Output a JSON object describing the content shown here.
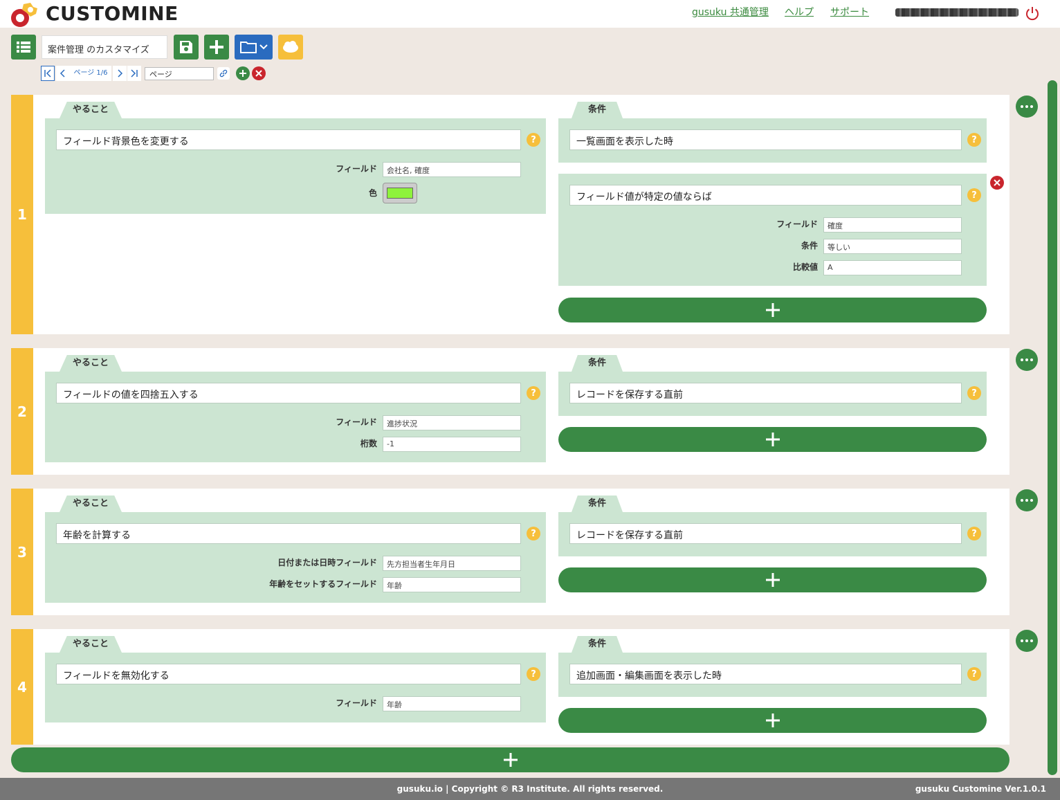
{
  "header": {
    "logo_text": "CUSTOMINE",
    "links": [
      "gusuku 共通管理",
      "ヘルプ",
      "サポート"
    ]
  },
  "toolbar": {
    "app_name": "案件管理 のカスタマイズ",
    "page_label": "ページ 1/6",
    "page_input": "ページ"
  },
  "rules": [
    {
      "number": "1",
      "action": {
        "tab": "やること",
        "name": "フィールド背景色を変更する",
        "params": [
          {
            "label": "フィールド",
            "value": "会社名, 確度"
          },
          {
            "label": "色",
            "value": ""
          }
        ]
      },
      "conditions_tab": "条件",
      "conditions": [
        {
          "name": "一覧画面を表示した時",
          "params": []
        },
        {
          "name": "フィールド値が特定の値ならば",
          "params": [
            {
              "label": "フィールド",
              "value": "確度"
            },
            {
              "label": "条件",
              "value": "等しい"
            },
            {
              "label": "比較値",
              "value": "A"
            }
          ]
        }
      ]
    },
    {
      "number": "2",
      "action": {
        "tab": "やること",
        "name": "フィールドの値を四捨五入する",
        "params": [
          {
            "label": "フィールド",
            "value": "進捗状況"
          },
          {
            "label": "桁数",
            "value": "-1"
          }
        ]
      },
      "conditions_tab": "条件",
      "conditions": [
        {
          "name": "レコードを保存する直前",
          "params": []
        }
      ]
    },
    {
      "number": "3",
      "action": {
        "tab": "やること",
        "name": "年齢を計算する",
        "params": [
          {
            "label": "日付または日時フィールド",
            "value": "先方担当者生年月日"
          },
          {
            "label": "年齢をセットするフィールド",
            "value": "年齢"
          }
        ]
      },
      "conditions_tab": "条件",
      "conditions": [
        {
          "name": "レコードを保存する直前",
          "params": []
        }
      ]
    },
    {
      "number": "4",
      "action": {
        "tab": "やること",
        "name": "フィールドを無効化する",
        "params": [
          {
            "label": "フィールド",
            "value": "年齢"
          }
        ]
      },
      "conditions_tab": "条件",
      "conditions": [
        {
          "name": "追加画面・編集画面を表示した時",
          "params": []
        }
      ]
    }
  ],
  "help_glyph": "?",
  "footer": {
    "copyright": "gusuku.io | Copyright © R3 Institute. All rights reserved.",
    "version": "gusuku Customine Ver.1.0.1"
  },
  "colors": {
    "brand_green": "#3a8a45",
    "rule_yellow": "#f6bf3b",
    "panel_green": "#cce5d2",
    "delete_red": "#c9252d",
    "swatch_color": "#8ef23c"
  },
  "icons": [
    "logo-icon",
    "list-icon",
    "save-icon",
    "plus-icon",
    "folder-icon",
    "chevron-down-icon",
    "kintone-cloud-icon",
    "first-page-icon",
    "prev-page-icon",
    "next-page-icon",
    "last-page-icon",
    "link-icon",
    "power-icon",
    "more-icon",
    "delete-icon",
    "help-icon"
  ]
}
